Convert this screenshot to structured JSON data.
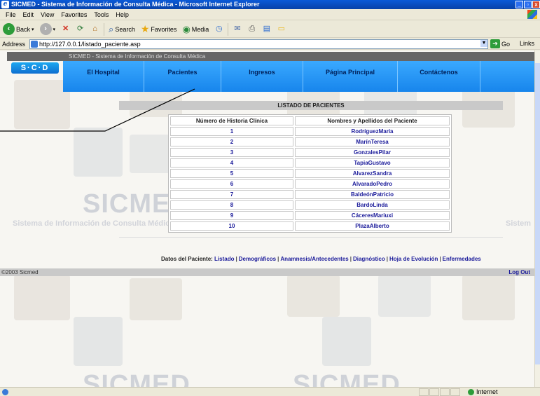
{
  "window": {
    "title": "SICMED - Sistema de Información de Consulta Médica - Microsoft Internet Explorer",
    "min": "_",
    "max": "▫",
    "close": "x"
  },
  "menu": [
    "File",
    "Edit",
    "View",
    "Favorites",
    "Tools",
    "Help"
  ],
  "toolbar": {
    "back": "Back",
    "search": "Search",
    "favorites": "Favorites",
    "media": "Media"
  },
  "address": {
    "label": "Address",
    "url": "http://127.0.0.1/listado_paciente.asp",
    "go": "Go",
    "links": "Links"
  },
  "site": {
    "title": "SICMED - Sistema de Información de Consulta Médica",
    "logo": "S·C·D",
    "nav": [
      "El Hospital",
      "Pacientes",
      "Ingresos",
      "Página Principal",
      "Contáctenos",
      ""
    ],
    "watermark": "SICMED",
    "watermark_sub": "Sistema de Información de Consulta Médica",
    "watermark_sub_short": "Sistem"
  },
  "listing": {
    "title": "LISTADO DE PACIENTES",
    "columns": [
      "Número de Historia Clínica",
      "Nombres y Apellidos del Paciente"
    ],
    "rows": [
      [
        "1",
        "RodríguezMaría"
      ],
      [
        "2",
        "MarínTeresa"
      ],
      [
        "3",
        "GonzalesPilar"
      ],
      [
        "4",
        "TapiaGustavo"
      ],
      [
        "5",
        "AlvarezSandra"
      ],
      [
        "6",
        "AlvaradoPedro"
      ],
      [
        "7",
        "BaldeónPatricio"
      ],
      [
        "8",
        "BardoLinda"
      ],
      [
        "9",
        "CáceresMariuxi"
      ],
      [
        "10",
        "PlazaAlberto"
      ]
    ]
  },
  "patient_nav": {
    "label": "Datos del Paciente:",
    "links": [
      "Listado",
      "Demográficos",
      "Anamnesis/Antecedentes",
      "Diagnóstico",
      "Hoja de Evolución",
      "Enfermedades"
    ]
  },
  "footer": {
    "copyright": "©2003 Sicmed",
    "logout": "Log Out"
  },
  "status": {
    "zone": "Internet"
  }
}
